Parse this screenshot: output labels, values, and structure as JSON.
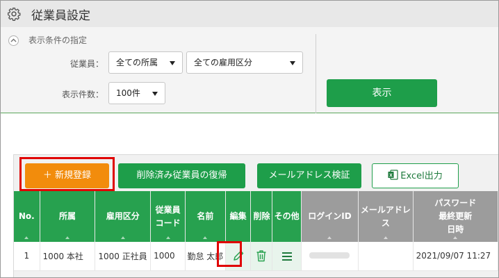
{
  "header": {
    "title": "従業員設定",
    "icon": "gear-icon"
  },
  "conditions": {
    "title": "表示条件の指定",
    "employee_label": "従業員：",
    "affiliation_value": "全ての所属",
    "employment_value": "全ての雇用区分",
    "count_label": "表示件数：",
    "count_value": "100件",
    "show_button": "表示"
  },
  "actions": {
    "new": "＋ 新規登録",
    "restore": "削除済み従業員の復帰",
    "verify_email": "メールアドレス検証",
    "excel": "Excel出力"
  },
  "table": {
    "headers": {
      "no": "No.",
      "dept": "所属",
      "emp_type": "雇用区分",
      "code_l1": "従業員",
      "code_l2": "コード",
      "name": "名前",
      "edit": "編集",
      "delete": "削除",
      "other": "その他",
      "login": "ログインID",
      "mail": "メールアドレス",
      "pw_l1": "パスワード",
      "pw_l2": "最終更新",
      "pw_l3": "日時"
    },
    "rows": [
      {
        "no": "1",
        "dept": "1000 本社",
        "emp_type": "1000 正社員",
        "code": "1000",
        "name": "勤怠 太郎",
        "mail": "",
        "pw_updated": "2021/09/07 11:27"
      }
    ]
  },
  "colors": {
    "green": "#1e9e4a",
    "orange": "#f28c0c",
    "highlight": "#e00000",
    "gray_header": "#9c9c9c"
  }
}
